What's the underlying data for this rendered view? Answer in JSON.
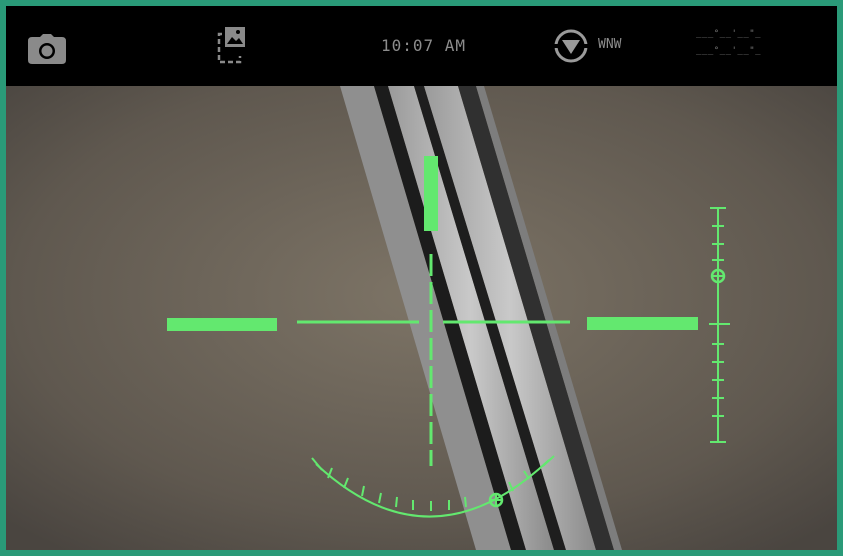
{
  "status_bar": {
    "time": "10:07 AM",
    "heading": "WNW",
    "coords_line1": "___°__'__\"_",
    "coords_line2": "___°__'__\"_"
  },
  "icons": {
    "camera": "camera-icon",
    "gallery": "gallery-icon",
    "compass": "compass-icon"
  },
  "colors": {
    "hud_green": "#63e86f",
    "bar_bg": "#000000",
    "frame_border": "#2a9a78"
  }
}
